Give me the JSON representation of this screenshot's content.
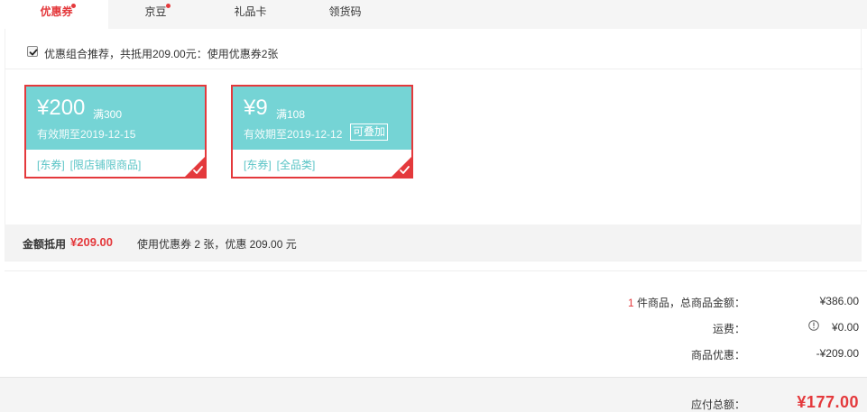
{
  "tabs": [
    {
      "label": "优惠券",
      "active": true,
      "has_dot": true
    },
    {
      "label": "京豆",
      "active": false,
      "has_dot": true
    },
    {
      "label": "礼品卡",
      "active": false,
      "has_dot": false
    },
    {
      "label": "领货码",
      "active": false,
      "has_dot": false
    }
  ],
  "combo": {
    "checked": true,
    "text": "优惠组合推荐，共抵用209.00元：使用优惠券2张"
  },
  "coupons": [
    {
      "amount": "¥200",
      "threshold": "满300",
      "expiry": "有效期至2019-12-15",
      "tags": [
        "[东券]",
        "[限店铺限商品]"
      ],
      "stackable_label": "",
      "selected": true
    },
    {
      "amount": "¥9",
      "threshold": "满108",
      "expiry": "有效期至2019-12-12",
      "tags": [
        "[东券]",
        "[全品类]"
      ],
      "stackable_label": "可叠加",
      "selected": true
    }
  ],
  "summary": {
    "label": "金额抵用",
    "amount": "¥209.00",
    "description": "使用优惠券 2 张，优惠 209.00 元"
  },
  "totals": {
    "item_count": "1",
    "item_count_suffix": " 件商品，总商品金额：",
    "goods_total": "¥386.00",
    "shipping_label": "运费：",
    "shipping_value": "¥0.00",
    "discount_label": "商品优惠：",
    "discount_value": "-¥209.00"
  },
  "payable": {
    "label": "应付总额：",
    "value": "¥177.00"
  },
  "colors": {
    "accent_red": "#e4393c",
    "coupon_teal": "#75d4d5",
    "tag_teal": "#59c4c6",
    "shipping_orange": "#ff6a00"
  },
  "icons": {
    "checkbox": "checkmark-icon",
    "coupon_selected": "corner-check-icon",
    "shipping_info": "info-circle-icon"
  }
}
